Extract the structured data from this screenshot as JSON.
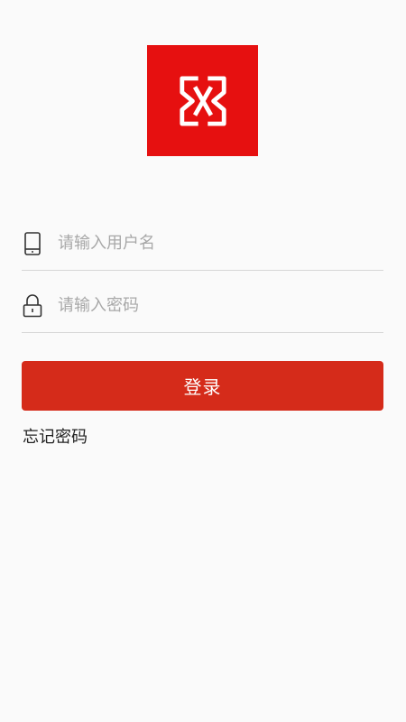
{
  "brand": {
    "logo_color": "#e61010",
    "logo_icon": "app-logo-icon"
  },
  "login_form": {
    "username": {
      "icon": "phone-icon",
      "placeholder": "请输入用户名",
      "value": ""
    },
    "password": {
      "icon": "lock-icon",
      "placeholder": "请输入密码",
      "value": ""
    },
    "submit_label": "登录",
    "submit_color": "#d52b1a",
    "forgot_password_label": "忘记密码"
  }
}
